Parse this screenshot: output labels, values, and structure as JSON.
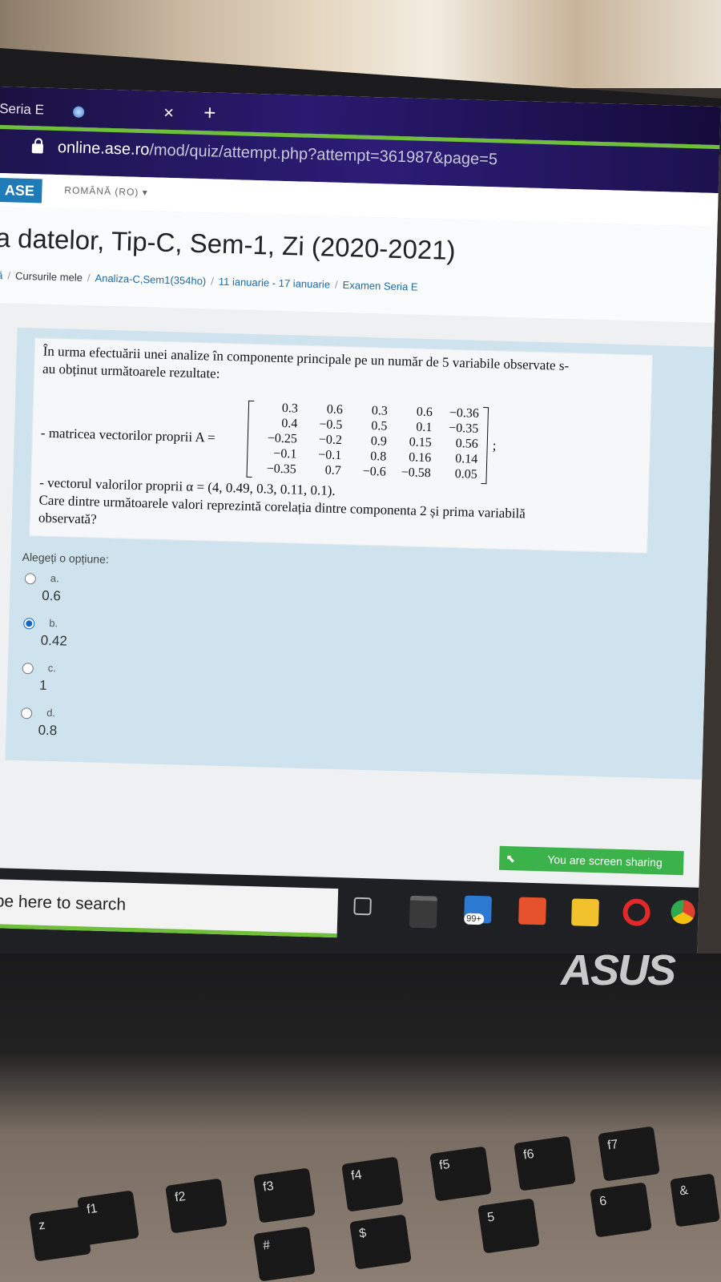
{
  "browser": {
    "tab_title": "Seria E",
    "tab_close": "×",
    "new_tab": "+",
    "url_host": "online.ase.ro",
    "url_path": "/mod/quiz/attempt.php?attempt=361987&page=5"
  },
  "navbar": {
    "logo": "ASE",
    "language": "ROMÂNĂ (RO) ▾"
  },
  "page": {
    "title": "a datelor, Tip-C, Sem-1, Zi (2020-2021)",
    "breadcrumb": [
      "lă",
      "Cursurile mele",
      "Analiza-C,Sem1(354ho)",
      "11 ianuarie - 17 ianuarie",
      "Examen Seria E"
    ]
  },
  "question": {
    "intro_line1": "În urma efectuării unei analize în componente principale pe un număr de 5 variabile observate s-",
    "intro_line2": "au obținut următoarele rezultate:",
    "matrix_label": "- matricea vectorilor proprii A =",
    "matrix_suffix": ";",
    "matrix": [
      [
        "0.3",
        "0.6",
        "0.3",
        "0.6",
        "−0.36"
      ],
      [
        "0.4",
        "−0.5",
        "0.5",
        "0.1",
        "−0.35"
      ],
      [
        "−0.25",
        "−0.2",
        "0.9",
        "0.15",
        "0.56"
      ],
      [
        "−0.1",
        "−0.1",
        "0.8",
        "0.16",
        "0.14"
      ],
      [
        "−0.35",
        "0.7",
        "−0.6",
        "−0.58",
        "0.05"
      ]
    ],
    "eigen_line": "- vectorul valorilor proprii α = (4, 0.49, 0.3, 0.11, 0.1).",
    "ask_line1": "Care dintre următoarele valori reprezintă corelația dintre componenta 2 și prima variabilă",
    "ask_line2": "observată?",
    "options_label": "Alegeți o opțiune:",
    "options": [
      {
        "letter": "a.",
        "value": "0.6",
        "selected": false
      },
      {
        "letter": "b.",
        "value": "0.42",
        "selected": true
      },
      {
        "letter": "c.",
        "value": "1",
        "selected": false
      },
      {
        "letter": "d.",
        "value": "0.8",
        "selected": false
      }
    ]
  },
  "sharing": {
    "text": "You are screen sharing"
  },
  "taskbar": {
    "search_placeholder": "Type here to search",
    "mail_badge": "99+"
  },
  "laptop": {
    "brand": "ASUS",
    "keys": [
      "f1",
      "f2",
      "f3",
      "f4",
      "f5",
      "f6",
      "f7",
      "z",
      "$",
      "%",
      "5",
      "6",
      "&",
      "#"
    ]
  }
}
